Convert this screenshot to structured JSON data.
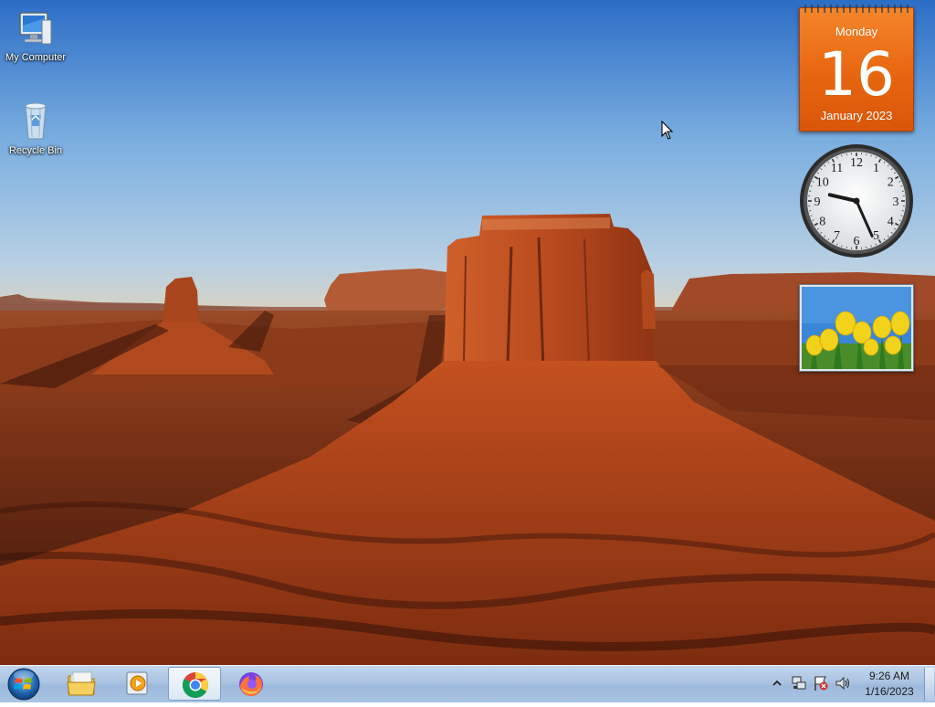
{
  "desktop": {
    "icons": [
      {
        "label": "My Computer",
        "icon": "computer-icon"
      },
      {
        "label": "Recycle Bin",
        "icon": "recycle-bin-icon"
      }
    ]
  },
  "gadgets": {
    "calendar": {
      "weekday": "Monday",
      "date": "16",
      "month_year": "January 2023"
    },
    "clock": {
      "numerals": [
        "12",
        "1",
        "2",
        "3",
        "4",
        "5",
        "6",
        "7",
        "8",
        "9",
        "10",
        "11"
      ],
      "time": "9:26"
    },
    "slideshow": {
      "image": "yellow-tulips-photo"
    }
  },
  "taskbar": {
    "start": {
      "icon": "windows-start-orb-icon"
    },
    "pinned": [
      {
        "name": "Windows Explorer",
        "icon": "folder-icon",
        "active": false
      },
      {
        "name": "Windows Media Player",
        "icon": "media-player-icon",
        "active": false
      },
      {
        "name": "Google Chrome",
        "icon": "chrome-icon",
        "active": true
      },
      {
        "name": "Firefox",
        "icon": "firefox-icon",
        "active": false
      }
    ],
    "tray": {
      "icons": [
        "show-hidden-icons-arrow",
        "network-icon",
        "action-center-flag-icon",
        "volume-icon"
      ],
      "time": "9:26 AM",
      "date": "1/16/2023"
    }
  },
  "colors": {
    "calendar_orange": "#e8650f",
    "taskbar_blue": "#aac3e2",
    "sky_blue": "#5f98d8",
    "rock_red": "#b4431c"
  }
}
